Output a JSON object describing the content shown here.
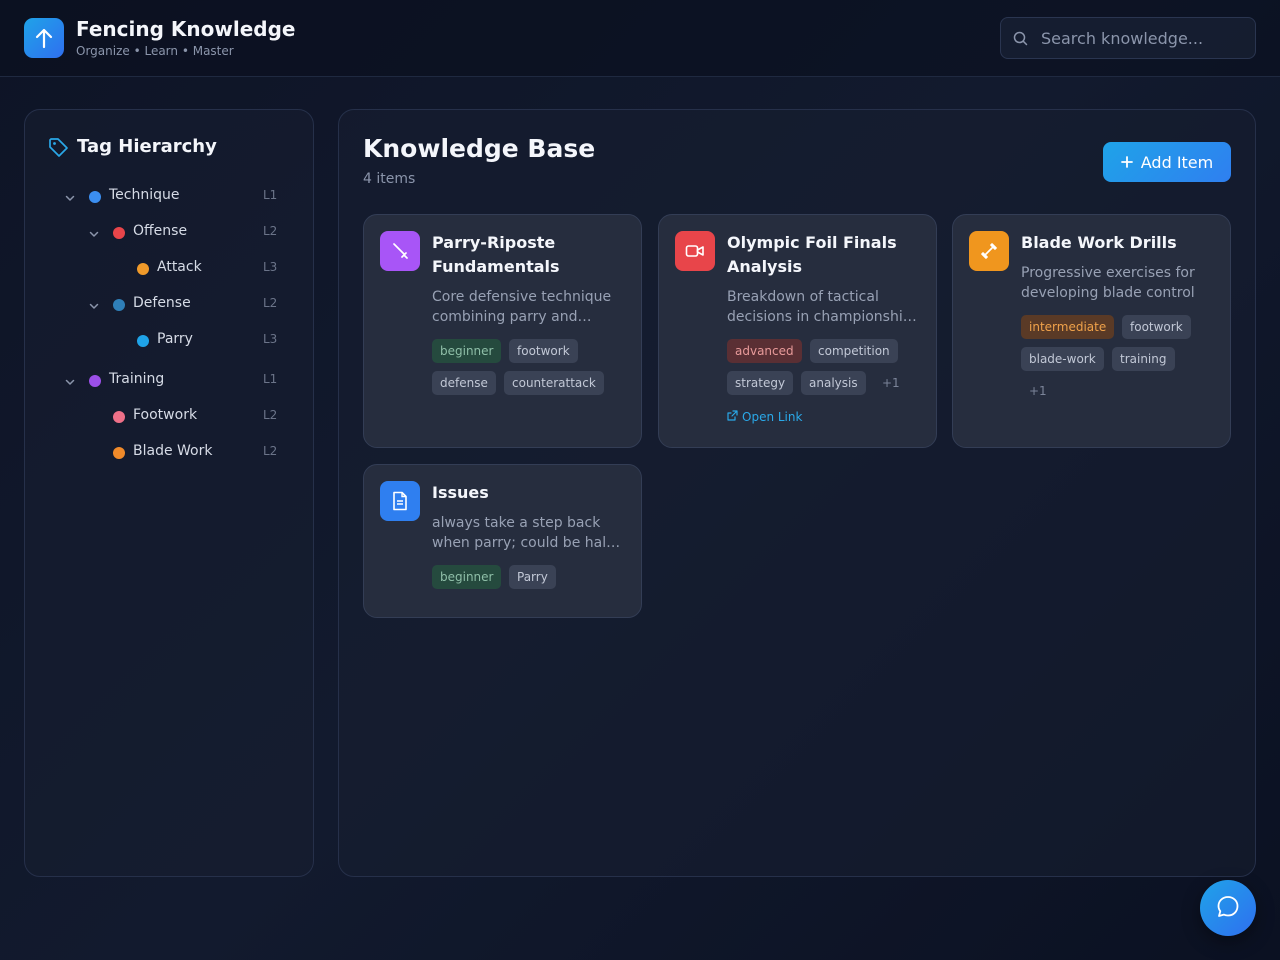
{
  "header": {
    "title": "Fencing Knowledge",
    "subtitle": "Organize • Learn • Master",
    "search_placeholder": "Search knowledge..."
  },
  "sidebar": {
    "title": "Tag Hierarchy",
    "tags": [
      {
        "label": "Technique",
        "level": "L1",
        "color": "#3b8ef0",
        "expanded": true
      },
      {
        "label": "Offense",
        "level": "L2",
        "color": "#e8454a",
        "expanded": true
      },
      {
        "label": "Attack",
        "level": "L3",
        "color": "#f09a2a"
      },
      {
        "label": "Defense",
        "level": "L2",
        "color": "#2f7fb8",
        "expanded": true
      },
      {
        "label": "Parry",
        "level": "L3",
        "color": "#1fa3e8"
      },
      {
        "label": "Training",
        "level": "L1",
        "color": "#9b4fe8",
        "expanded": true
      },
      {
        "label": "Footwork",
        "level": "L2",
        "color": "#ee7088"
      },
      {
        "label": "Blade Work",
        "level": "L2",
        "color": "#f08a2a"
      }
    ]
  },
  "main": {
    "title": "Knowledge Base",
    "count": "4 items",
    "add_label": "Add Item",
    "cards": [
      {
        "title": "Parry-Riposte Fundamentals",
        "desc": "Core defensive technique combining parry and…",
        "icon": "sword-icon",
        "icon_color": "#a855f7",
        "tags": [
          "beginner",
          "footwork",
          "defense",
          "counterattack"
        ]
      },
      {
        "title": "Olympic Foil Finals Analysis",
        "desc": "Breakdown of tactical decisions in championshi…",
        "icon": "video-icon",
        "icon_color": "#e8454a",
        "tags": [
          "advanced",
          "competition",
          "strategy",
          "analysis"
        ],
        "more": "+1",
        "link": "Open Link"
      },
      {
        "title": "Blade Work Drills",
        "desc": "Progressive exercises for developing blade control",
        "icon": "dumbbell-icon",
        "icon_color": "#f0961e",
        "tags": [
          "intermediate",
          "footwork",
          "blade-work",
          "training"
        ],
        "more": "+1"
      },
      {
        "title": "Issues",
        "desc": "always take a step back when parry; could be hal…",
        "icon": "document-icon",
        "icon_color": "#2f7ff0",
        "tags": [
          "beginner",
          "Parry"
        ]
      }
    ]
  }
}
